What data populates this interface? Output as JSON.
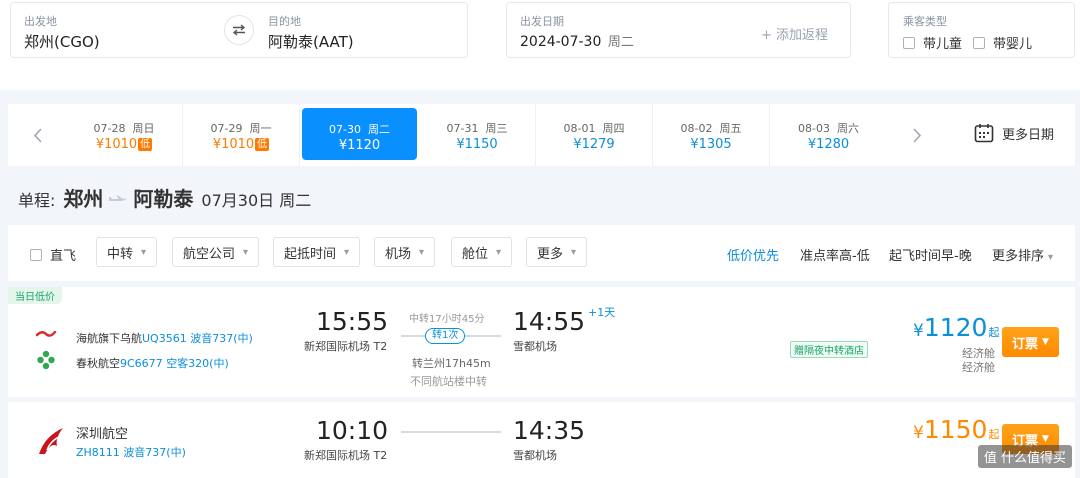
{
  "search": {
    "from_label": "出发地",
    "from_value": "郑州(CGO)",
    "to_label": "目的地",
    "to_value": "阿勒泰(AAT)",
    "date_label": "出发日期",
    "date_value": "2024-07-30",
    "date_weekday": "周二",
    "add_return": "+ 添加返程",
    "pax_label": "乘客类型",
    "pax_child": "带儿童",
    "pax_infant": "带婴儿"
  },
  "date_strip": {
    "cells": [
      {
        "date": "07-28",
        "weekday": "周日",
        "price": "¥1010",
        "low": "低"
      },
      {
        "date": "07-29",
        "weekday": "周一",
        "price": "¥1010",
        "low": "低"
      },
      {
        "date": "07-30",
        "weekday": "周二",
        "price": "¥1120"
      },
      {
        "date": "07-31",
        "weekday": "周三",
        "price": "¥1150"
      },
      {
        "date": "08-01",
        "weekday": "周四",
        "price": "¥1279"
      },
      {
        "date": "08-02",
        "weekday": "周五",
        "price": "¥1305"
      },
      {
        "date": "08-03",
        "weekday": "周六",
        "price": "¥1280"
      }
    ],
    "more_dates": "更多日期"
  },
  "route": {
    "label": "单程:",
    "from": "郑州",
    "to": "阿勒泰",
    "date": "07月30日 周二"
  },
  "filters": {
    "direct": "直飞",
    "transfer": "中转",
    "airline": "航空公司",
    "time": "起抵时间",
    "airport": "机场",
    "cabin": "舱位",
    "more": "更多",
    "sort_low_price": "低价优先",
    "sort_punctual": "准点率高-低",
    "sort_early": "起飞时间早-晚",
    "sort_more": "更多排序"
  },
  "flights": [
    {
      "badge": "当日低价",
      "seg1_airline": "海航旗下乌航",
      "seg1_flight": "UQ3561",
      "seg1_aircraft": "波音737(中)",
      "seg2_airline": "春秋航空",
      "seg2_flight": "9C6677",
      "seg2_aircraft": "空客320(中)",
      "dep_time": "15:55",
      "dep_airport": "新郑国际机场 T2",
      "arr_time": "14:55",
      "arr_airport": "雪都机场",
      "plus_day": "+1天",
      "transfer_duration": "中转17小时45分",
      "transfer_count": "转1次",
      "transfer_city": "转兰州17h45m",
      "transfer_note": "不同航站楼中转",
      "hotel_tag": "赠隔夜中转酒店",
      "price_currency": "¥",
      "price": "1120",
      "price_suffix": "起",
      "cabin1": "经济舱",
      "cabin2": "经济舱",
      "book": "订票"
    },
    {
      "airline": "深圳航空",
      "flight": "ZH8111",
      "aircraft": "波音737(中)",
      "dep_time": "10:10",
      "dep_airport": "新郑国际机场 T2",
      "arr_time": "14:35",
      "arr_airport": "雪都机场",
      "price_currency": "¥",
      "price": "1150",
      "price_suffix": "起",
      "book": "订票"
    }
  ],
  "watermark": "值 什么值得买",
  "colors": {
    "accent": "#0a8fff",
    "price_blue": "#0a8fdb",
    "price_orange": "#ff8a00",
    "low_tag": "#ff7a00",
    "green": "#17a36a"
  }
}
